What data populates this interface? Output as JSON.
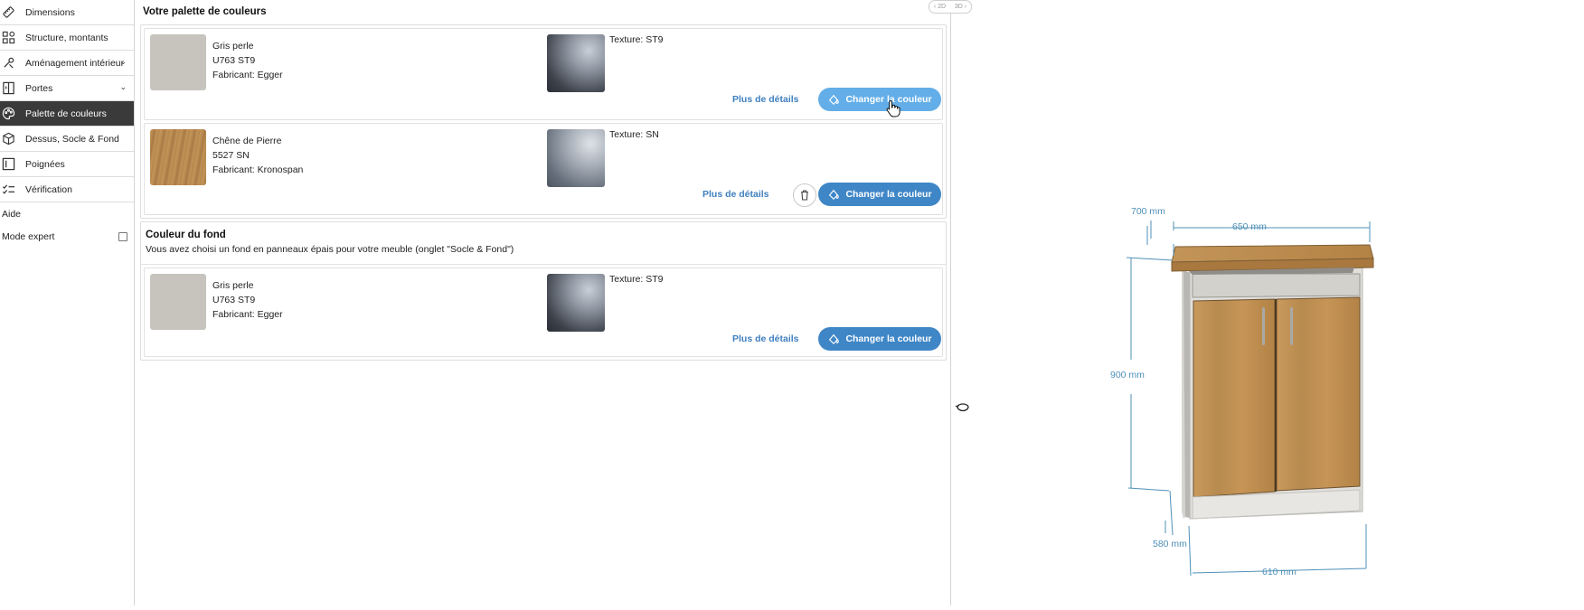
{
  "sidebar": {
    "items": [
      {
        "label": "Dimensions",
        "icon": "ruler-icon",
        "active": false,
        "chevron": false
      },
      {
        "label": "Structure, montants",
        "icon": "structure-icon",
        "active": false,
        "chevron": false
      },
      {
        "label": "Aménagement intérieur",
        "icon": "tools-icon",
        "active": false,
        "chevron": true
      },
      {
        "label": "Portes",
        "icon": "door-icon",
        "active": false,
        "chevron": true
      },
      {
        "label": "Palette de couleurs",
        "icon": "palette-icon",
        "active": true,
        "chevron": false
      },
      {
        "label": "Dessus, Socle & Fond",
        "icon": "cube-icon",
        "active": false,
        "chevron": false
      },
      {
        "label": "Poignées",
        "icon": "handle-icon",
        "active": false,
        "chevron": false
      },
      {
        "label": "Vérification",
        "icon": "checklist-icon",
        "active": false,
        "chevron": false
      }
    ],
    "help_label": "Aide",
    "expert_label": "Mode expert"
  },
  "palette": {
    "title": "Votre palette de couleurs",
    "items": [
      {
        "name": "Gris perle",
        "code": "U763 ST9",
        "maker": "Fabricant: Egger",
        "texture": "Texture: ST9",
        "details": "Plus de détails",
        "button": "Changer la couleur",
        "swatch_color": "#c7c4be"
      },
      {
        "name": "Chêne de Pierre",
        "code": "5527 SN",
        "maker": "Fabricant: Kronospan",
        "texture": "Texture: SN",
        "details": "Plus de détails",
        "button": "Changer la couleur",
        "swatch_color": "#b98c55"
      }
    ]
  },
  "fond": {
    "title": "Couleur du fond",
    "description": "Vous avez choisi un fond en panneaux épais pour votre meuble (onglet \"Socle & Fond\")",
    "item": {
      "name": "Gris perle",
      "code": "U763 ST9",
      "maker": "Fabricant: Egger",
      "texture": "Texture: ST9",
      "details": "Plus de détails",
      "button": "Changer la couleur",
      "swatch_color": "#c7c4be"
    }
  },
  "view_toggle": {
    "left": "2D",
    "right": "3D"
  },
  "dimensions": {
    "depth_top": "700 mm",
    "width_top": "650 mm",
    "height": "900 mm",
    "depth_bottom": "580 mm",
    "width_bottom": "610 mm"
  },
  "colors": {
    "accent": "#3f86c7",
    "accent_hover": "#63aee8",
    "link": "#3f7fbf",
    "dimension": "#4f90b7",
    "sidebar_active": "#3a3a3a"
  }
}
